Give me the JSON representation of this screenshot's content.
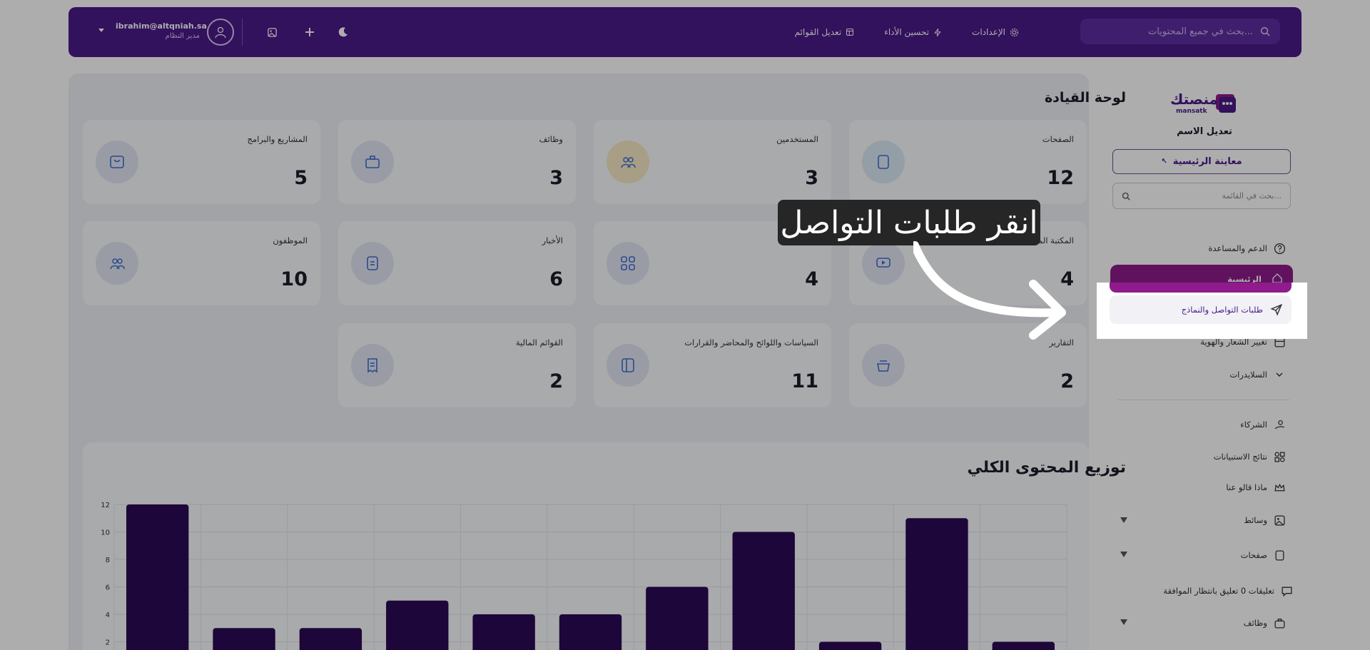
{
  "topbar": {
    "search_placeholder": "بحث في جميع المحتويات...",
    "nav": [
      {
        "label": "الإعدادات",
        "icon": "gear-icon"
      },
      {
        "label": "تحسين الأداء",
        "icon": "lightning-icon"
      },
      {
        "label": "تعديل القوائم",
        "icon": "layout-icon"
      }
    ],
    "user_email": "ibrahim@altqniah.sa",
    "user_role": "مدير النظام"
  },
  "page_title": "لوحة القيادة",
  "cards": [
    {
      "label": "الصفحات",
      "value": "12",
      "icon": "notebook-icon",
      "color": "#dbe9f7"
    },
    {
      "label": "المستخدمين",
      "value": "3",
      "icon": "users-icon",
      "color": "#f6e9c4"
    },
    {
      "label": "وظائف",
      "value": "3",
      "icon": "briefcase-icon",
      "color": "#e3e6f4"
    },
    {
      "label": "المشاريع والبرامج",
      "value": "5",
      "icon": "bag-icon",
      "color": "#e3e6f4"
    },
    {
      "label": "المكتبة المرئية",
      "value": "4",
      "icon": "video-icon",
      "color": "#e3e6f4"
    },
    {
      "label": "",
      "value": "4",
      "icon": "grid-icon",
      "color": "#e3e6f4"
    },
    {
      "label": "الأخبار",
      "value": "6",
      "icon": "document-icon",
      "color": "#e3e6f4"
    },
    {
      "label": "الموظفون",
      "value": "10",
      "icon": "users-icon",
      "color": "#e3e6f4"
    },
    {
      "label": "التقارير",
      "value": "2",
      "icon": "basket-icon",
      "color": "#e3e6f4"
    },
    {
      "label": "السياسات واللوائح والمحاضر والقرارات",
      "value": "11",
      "icon": "book-icon",
      "color": "#e3e6f4"
    },
    {
      "label": "القوائم المالية",
      "value": "2",
      "icon": "receipt-icon",
      "color": "#e3e6f4"
    }
  ],
  "chart_title": "توزيع المحتوى الكلي",
  "chart_data": {
    "type": "bar",
    "values": [
      12,
      3,
      3,
      5,
      4,
      4,
      6,
      10,
      2,
      11,
      2
    ],
    "yticks": [
      "2",
      "4",
      "6",
      "8",
      "10",
      "12"
    ],
    "ylim": [
      0,
      12
    ],
    "bar_color": "#2b0a55",
    "grid": true
  },
  "sidebar": {
    "edit_name": "تعديل الاسم",
    "preview_label": "معاينة الرئيسية",
    "menu_search_placeholder": "بحث في القائمة...",
    "items": [
      {
        "label": "الدعم والمساعدة",
        "icon": "question-icon"
      },
      {
        "label": "الرئيسية",
        "icon": "home-icon"
      },
      {
        "label": "طلبات التواصل والنماذج",
        "icon": "send-icon"
      },
      {
        "label": "تغيير الشعار والهوية",
        "icon": "palette-icon"
      },
      {
        "label": "السلايدرات",
        "icon": "chevron-down-icon"
      },
      {
        "label": "الشركاء",
        "icon": "handshake-icon"
      },
      {
        "label": "نتائج الاستبيانات",
        "icon": "shapes-icon"
      },
      {
        "label": "ماذا قالو عنا",
        "icon": "crown-icon"
      },
      {
        "label": "وسائط",
        "icon": "image-icon"
      },
      {
        "label": "صفحات",
        "icon": "pages-icon"
      },
      {
        "label": "تعليقات 0 تعليق بانتظار الموافقة",
        "icon": "comment-icon"
      },
      {
        "label": "وظائف",
        "icon": "briefcase-icon"
      }
    ]
  },
  "logo": {
    "text": "منصتك",
    "subtext": "mansatk"
  },
  "callout_text": "انقر طلبات التواصل",
  "colors": {
    "brand": "#4a1a8a",
    "accent": "#8f1b8d"
  }
}
